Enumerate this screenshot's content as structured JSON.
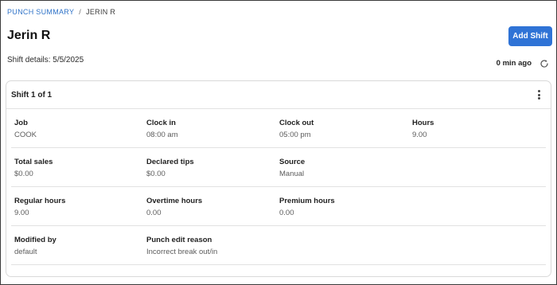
{
  "breadcrumb": {
    "parent": "PUNCH SUMMARY",
    "separator": "/",
    "current": "JERIN R"
  },
  "header": {
    "title": "Jerin R",
    "shift_details": "Shift details: 5/5/2025",
    "add_shift_label": "Add Shift",
    "updated_text": "0 min ago"
  },
  "card": {
    "title": "Shift 1 of 1",
    "rows": [
      [
        {
          "label": "Job",
          "value": "COOK"
        },
        {
          "label": "Clock in",
          "value": "08:00 am"
        },
        {
          "label": "Clock out",
          "value": "05:00 pm"
        },
        {
          "label": "Hours",
          "value": "9.00"
        }
      ],
      [
        {
          "label": "Total sales",
          "value": "$0.00"
        },
        {
          "label": "Declared tips",
          "value": "$0.00"
        },
        {
          "label": "Source",
          "value": "Manual"
        }
      ],
      [
        {
          "label": "Regular hours",
          "value": "9.00"
        },
        {
          "label": "Overtime hours",
          "value": "0.00"
        },
        {
          "label": "Premium hours",
          "value": "0.00"
        }
      ],
      [
        {
          "label": "Modified by",
          "value": "default"
        },
        {
          "label": "Punch edit reason",
          "value": "Incorrect break out/in"
        }
      ]
    ]
  },
  "colors": {
    "accent": "#2f73d6",
    "link": "#2f73c8"
  },
  "icons": {
    "refresh": "refresh-icon",
    "more": "kebab-menu-icon"
  }
}
